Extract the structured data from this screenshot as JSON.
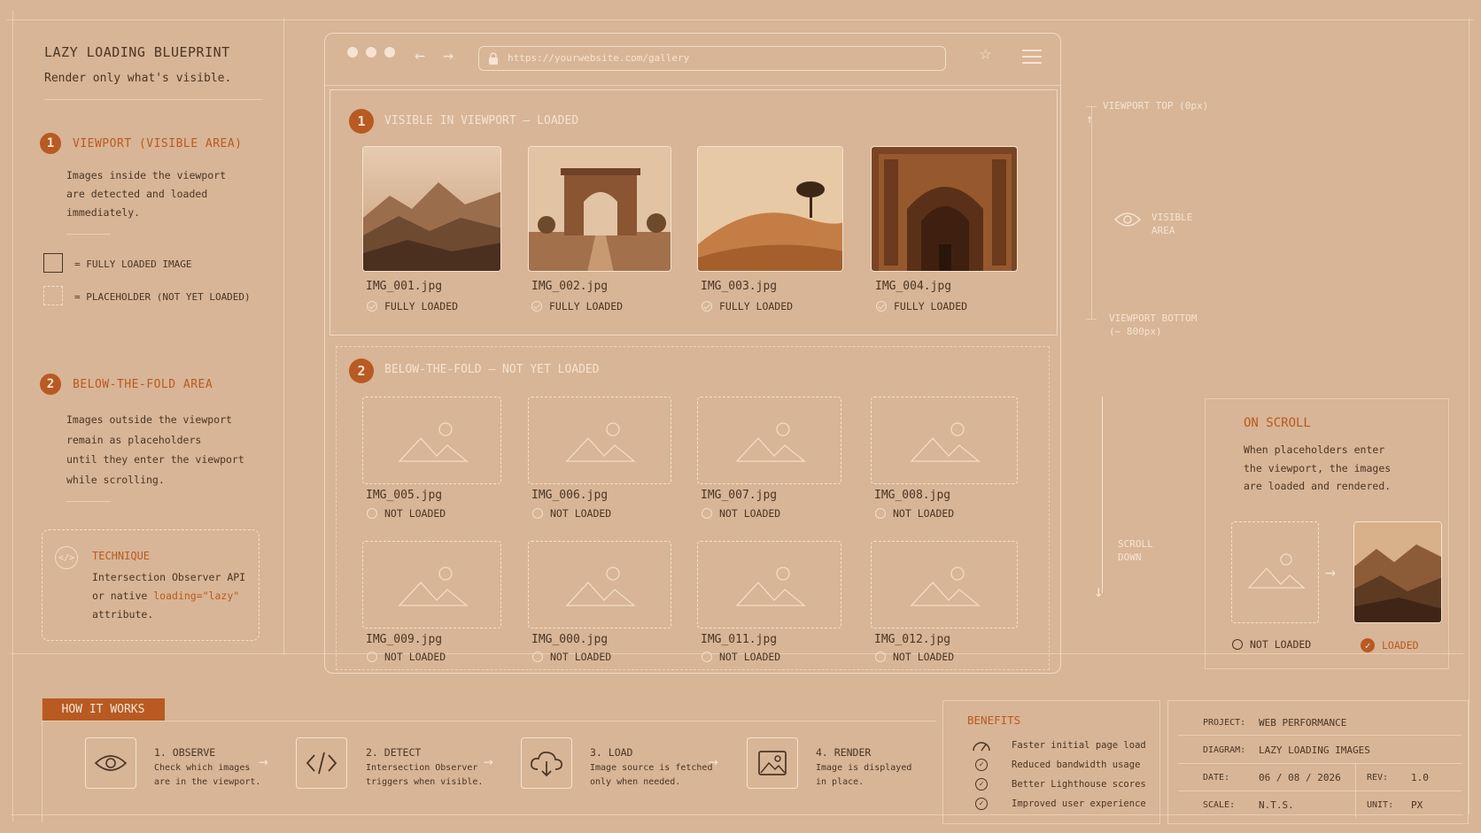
{
  "header": {
    "title": "LAZY LOADING BLUEPRINT",
    "subtitle": "Render only what's visible."
  },
  "legend_panel": {
    "viewport": {
      "num": "1",
      "title": "VIEWPORT (VISIBLE AREA)",
      "lines": [
        "Images inside the viewport",
        "are detected and loaded",
        "immediately."
      ]
    },
    "key": {
      "loaded": "= FULLY LOADED IMAGE",
      "placeholder": "= PLACEHOLDER (NOT YET LOADED)"
    },
    "below": {
      "num": "2",
      "title": "BELOW-THE-FOLD AREA",
      "lines": [
        "Images outside the viewport",
        "remain as placeholders",
        "until they enter the viewport",
        "while scrolling."
      ]
    },
    "technique": {
      "title": "TECHNIQUE",
      "line1": "Intersection Observer API",
      "line2_prefix": "or native ",
      "line2_code": "loading=\"lazy\"",
      "line3": "attribute."
    }
  },
  "browser": {
    "url": "https://yourwebsite.com/gallery"
  },
  "visible_section": {
    "num": "1",
    "title": "VISIBLE IN VIEWPORT – LOADED",
    "images": [
      {
        "name": "IMG_001.jpg",
        "status": "FULLY LOADED"
      },
      {
        "name": "IMG_002.jpg",
        "status": "FULLY LOADED"
      },
      {
        "name": "IMG_003.jpg",
        "status": "FULLY LOADED"
      },
      {
        "name": "IMG_004.jpg",
        "status": "FULLY LOADED"
      }
    ]
  },
  "below_section": {
    "num": "2",
    "title": "BELOW-THE-FOLD – NOT YET LOADED",
    "images": [
      {
        "name": "IMG_005.jpg",
        "status": "NOT LOADED"
      },
      {
        "name": "IMG_006.jpg",
        "status": "NOT LOADED"
      },
      {
        "name": "IMG_007.jpg",
        "status": "NOT LOADED"
      },
      {
        "name": "IMG_008.jpg",
        "status": "NOT LOADED"
      },
      {
        "name": "IMG_009.jpg",
        "status": "NOT LOADED"
      },
      {
        "name": "IMG_000.jpg",
        "status": "NOT LOADED"
      },
      {
        "name": "IMG_011.jpg",
        "status": "NOT LOADED"
      },
      {
        "name": "IMG_012.jpg",
        "status": "NOT LOADED"
      }
    ]
  },
  "viewport_annotations": {
    "top": "VIEWPORT TOP (0px)",
    "visible": [
      "VISIBLE",
      "AREA"
    ],
    "bottom": [
      "VIEWPORT BOTTOM",
      "(~ 800px)"
    ],
    "scroll": [
      "SCROLL",
      "DOWN"
    ]
  },
  "on_scroll": {
    "title": "ON SCROLL",
    "lines": [
      "When placeholders enter",
      "the viewport, the images",
      "are loaded and rendered."
    ],
    "before": "NOT LOADED",
    "after": "LOADED"
  },
  "how_it_works": {
    "label": "HOW IT WORKS",
    "steps": [
      {
        "title": "1. OBSERVE",
        "desc": [
          "Check which images",
          "are in the viewport."
        ],
        "icon": "eye-icon"
      },
      {
        "title": "2. DETECT",
        "desc": [
          "Intersection Observer",
          "triggers when visible."
        ],
        "icon": "code-icon"
      },
      {
        "title": "3. LOAD",
        "desc": [
          "Image source is fetched",
          "only when needed."
        ],
        "icon": "cloud-download-icon"
      },
      {
        "title": "4. RENDER",
        "desc": [
          "Image is displayed",
          "in place."
        ],
        "icon": "image-icon"
      }
    ]
  },
  "benefits": {
    "title": "BENEFITS",
    "items": [
      "Faster initial page load",
      "Reduced bandwidth usage",
      "Better Lighthouse scores",
      "Improved user experience"
    ]
  },
  "title_block": {
    "project_k": "PROJECT:",
    "project_v": "WEB PERFORMANCE",
    "diagram_k": "DIAGRAM:",
    "diagram_v": "LAZY LOADING IMAGES",
    "date_k": "DATE:",
    "date_v": "06 / 08 / 2026",
    "rev_k": "REV:",
    "rev_v": "1.0",
    "scale_k": "SCALE:",
    "scale_v": "N.T.S.",
    "unit_k": "UNIT:",
    "unit_v": "PX"
  },
  "colors": {
    "background": "#d8b596",
    "accent": "#b85a22",
    "ink": "#4a3526",
    "line": "#f1dcc8"
  }
}
